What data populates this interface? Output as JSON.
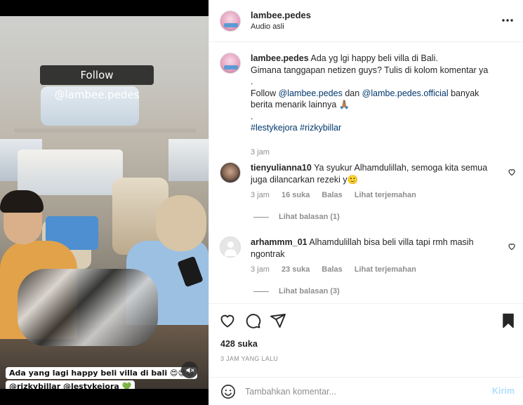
{
  "video": {
    "follow_overlay": "Follow @lambee.pedes",
    "caption_line1": "Ada yang lagi happy beli villa di bali 😍😍😍",
    "caption_line2": "@rizkybillar @lestykejora 💚",
    "mute_icon": "muted-speaker-icon"
  },
  "header": {
    "username": "lambee.pedes",
    "audio": "Audio asli",
    "more_icon": "more-options-icon"
  },
  "post": {
    "username": "lambee.pedes",
    "line1": "Ada yg lgi happy beli villa di Bali.",
    "line2": "Gimana tanggapan netizen guys? Tulis di kolom komentar ya",
    "dot1": ".",
    "follow_prefix": "Follow",
    "mention1": "@lambee.pedes",
    "follow_mid": "dan",
    "mention2": "@lambe.pedes.official",
    "follow_suffix": "banyak berita menarik lainnya 🙏🏽",
    "dot2": ".",
    "hashtags": "#lestykejora #rizkybillar",
    "time": "3 jam"
  },
  "comments": [
    {
      "username": "tienyulianna10",
      "text": "Ya syukur Alhamdulillah, semoga kita semua juga dilancarkan rezeki y🙂",
      "time": "3 jam",
      "likes": "16 suka",
      "reply": "Balas",
      "translate": "Lihat terjemahan",
      "view_replies": "Lihat balasan (1)"
    },
    {
      "username": "arhammm_01",
      "text": "Alhamdulillah bisa beli villa tapi rmh masih ngontrak",
      "time": "3 jam",
      "likes": "23 suka",
      "reply": "Balas",
      "translate": "Lihat terjemahan",
      "view_replies": "Lihat balasan (3)"
    }
  ],
  "actions": {
    "likes": "428 suka",
    "date": "3 JAM YANG LALU",
    "icons": [
      "heart-icon",
      "comment-icon",
      "share-icon",
      "bookmark-icon"
    ]
  },
  "add_comment": {
    "placeholder": "Tambahkan komentar...",
    "post_label": "Kirim"
  },
  "colors": {
    "link": "#00376b",
    "secondary_text": "#8e8e8e",
    "post_button_disabled": "#b2dffc"
  }
}
